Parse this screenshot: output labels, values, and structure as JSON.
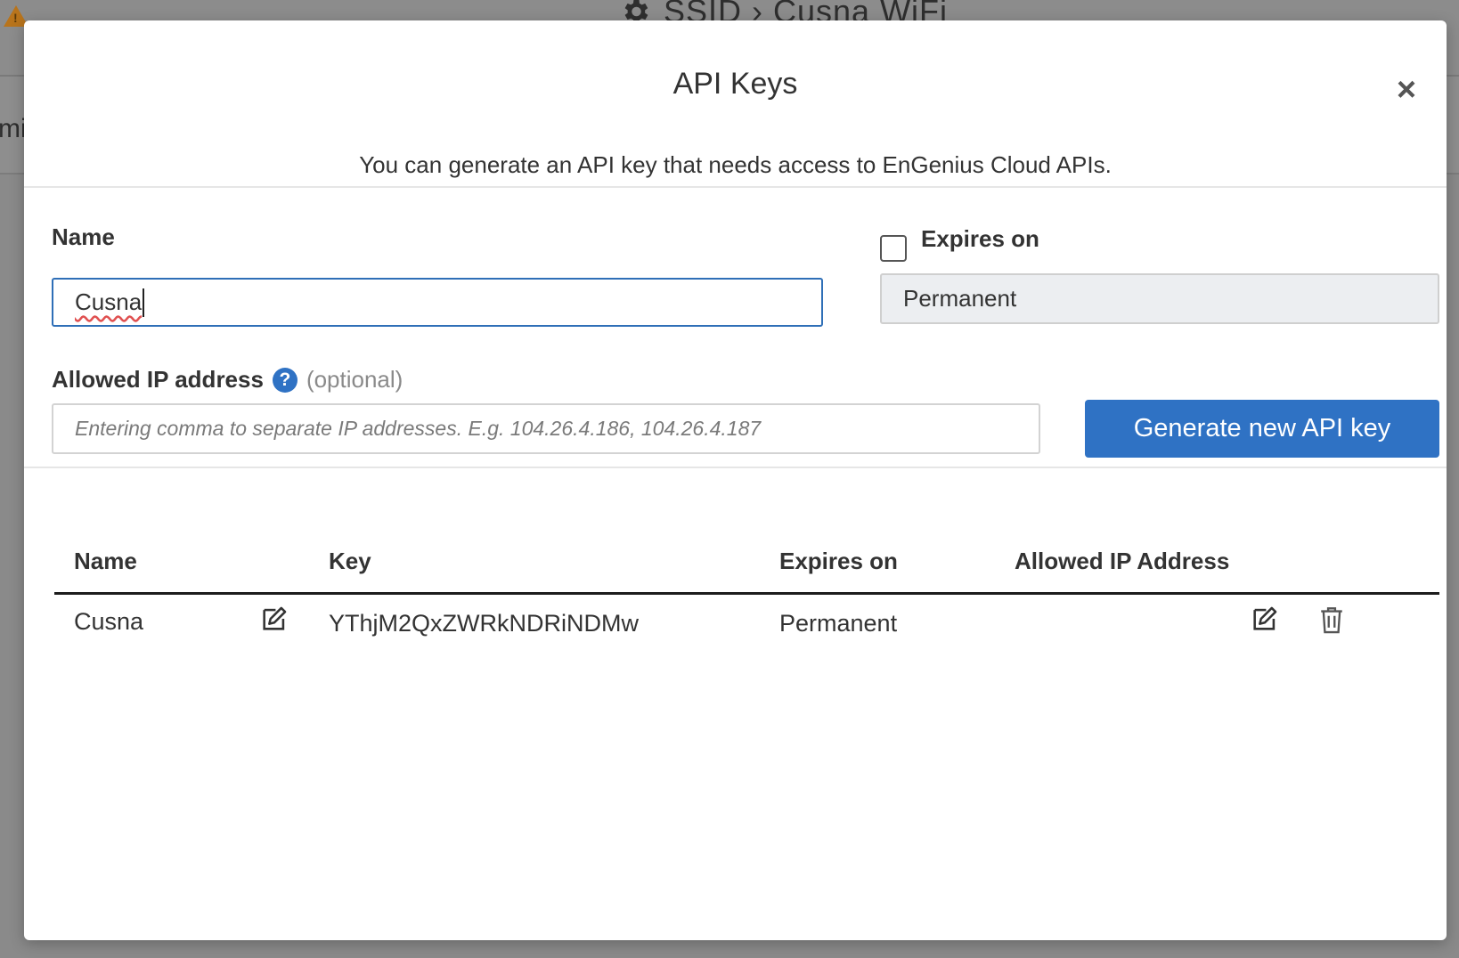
{
  "background": {
    "title": "SSID › Cusna WiFi",
    "tab_fragment": "mi"
  },
  "modal": {
    "title": "API Keys",
    "close_glyph": "×",
    "description": "You can generate an API key that needs access to EnGenius Cloud APIs."
  },
  "form": {
    "name_label": "Name",
    "name_value": "Cusna",
    "expires_label": "Expires on",
    "expires_checked": false,
    "expires_value": "Permanent",
    "ip_label": "Allowed IP address",
    "ip_optional": "(optional)",
    "ip_placeholder": "Entering comma to separate IP addresses. E.g. 104.26.4.186, 104.26.4.187",
    "generate_button": "Generate new API key",
    "help_glyph": "?"
  },
  "table": {
    "headers": {
      "name": "Name",
      "key": "Key",
      "expires": "Expires on",
      "allowed_ip": "Allowed IP Address"
    },
    "rows": [
      {
        "name": "Cusna",
        "key": "YThjM2QxZWRkNDRiNDMw",
        "expires": "Permanent",
        "allowed_ip": ""
      }
    ]
  },
  "colors": {
    "primary": "#2f72c4",
    "focus_border": "#2f6fb7",
    "warning": "#b8741c",
    "overlay": "#8a8a8a"
  },
  "icons": [
    "warning-icon",
    "gear-icon",
    "close-icon",
    "help-icon",
    "edit-icon",
    "trash-icon"
  ]
}
